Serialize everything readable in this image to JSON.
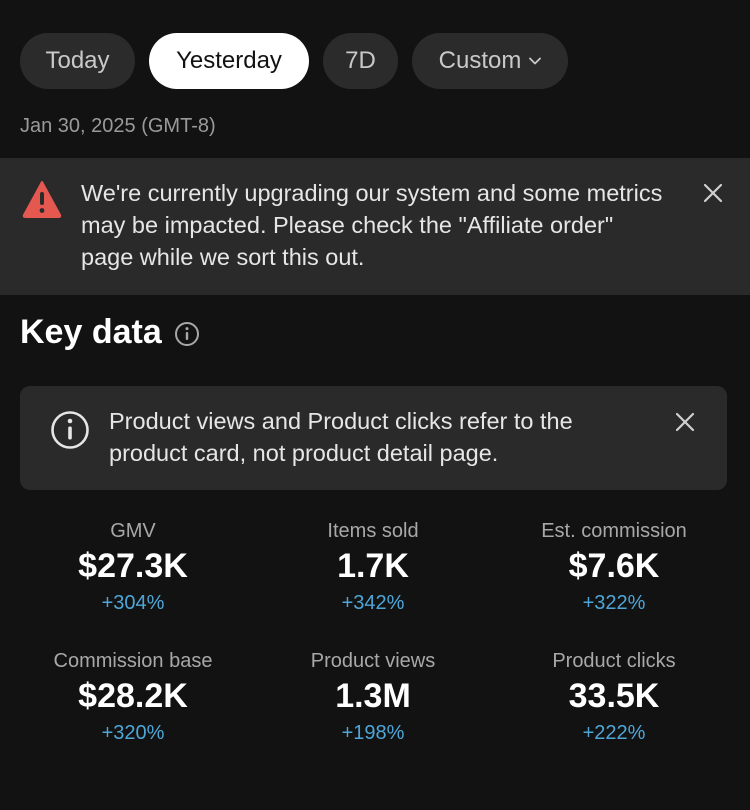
{
  "tabs": [
    {
      "label": "Today"
    },
    {
      "label": "Yesterday",
      "active": true
    },
    {
      "label": "7D"
    },
    {
      "label": "Custom"
    }
  ],
  "date_label": "Jan 30, 2025 (GMT-8)",
  "warning_banner": {
    "text": "We're currently upgrading our system and some metrics may be impacted. Please check the \"Affiliate order\" page while we sort this out.",
    "icon": "warning-triangle-icon",
    "icon_color": "#e5584f"
  },
  "key_data": {
    "title": "Key data",
    "info_icon": "info-circle-icon"
  },
  "info_note": {
    "text": "Product views and Product clicks refer to the product card, not product detail page.",
    "icon": "info-circle-icon"
  },
  "metrics": [
    {
      "label": "GMV",
      "value": "$27.3K",
      "change": "+304%"
    },
    {
      "label": "Items sold",
      "value": "1.7K",
      "change": "+342%"
    },
    {
      "label": "Est. commission",
      "value": "$7.6K",
      "change": "+322%"
    },
    {
      "label": "Commission base",
      "value": "$28.2K",
      "change": "+320%"
    },
    {
      "label": "Product views",
      "value": "1.3M",
      "change": "+198%"
    },
    {
      "label": "Product clicks",
      "value": "33.5K",
      "change": "+222%"
    }
  ],
  "colors": {
    "background": "#121212",
    "panel": "#2a2a2a",
    "positive_change": "#4ea6d8",
    "active_tab": "#ffffff"
  }
}
